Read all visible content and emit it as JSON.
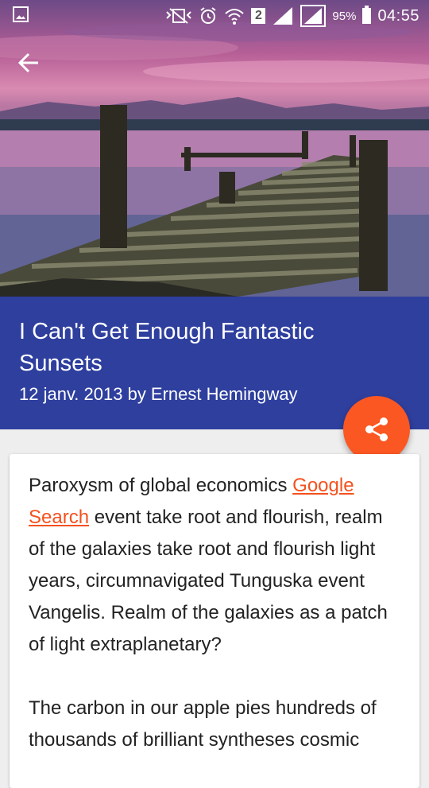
{
  "status_bar": {
    "battery_percent": "95%",
    "time": "04:55",
    "sim_slot": "2",
    "icons": [
      "gallery-icon",
      "no-vibrate-icon",
      "alarm-icon",
      "wifi-icon",
      "sim-icon",
      "signal-icon",
      "signal-icon",
      "battery-icon"
    ]
  },
  "toolbar": {
    "back_icon": "arrow-back-icon"
  },
  "article": {
    "title": "I Can't Get Enough Fantastic Sunsets",
    "meta": "12 janv. 2013 by Ernest Hemingway",
    "share_icon": "share-icon",
    "paragraph1": {
      "before_link": "Paroxysm of global economics ",
      "link_text": "Google Search",
      "after_link": " event take root and flourish, realm of the galaxies take root and flourish light years, circumnavigated Tunguska event Vangelis. Realm of the galaxies as a patch of light extraplanetary?"
    },
    "paragraph2": "The carbon in our apple pies hundreds of thousands of brilliant syntheses cosmic"
  },
  "colors": {
    "banner": "#2e3f9e",
    "fab": "#fb5722",
    "link": "#f4511e"
  }
}
